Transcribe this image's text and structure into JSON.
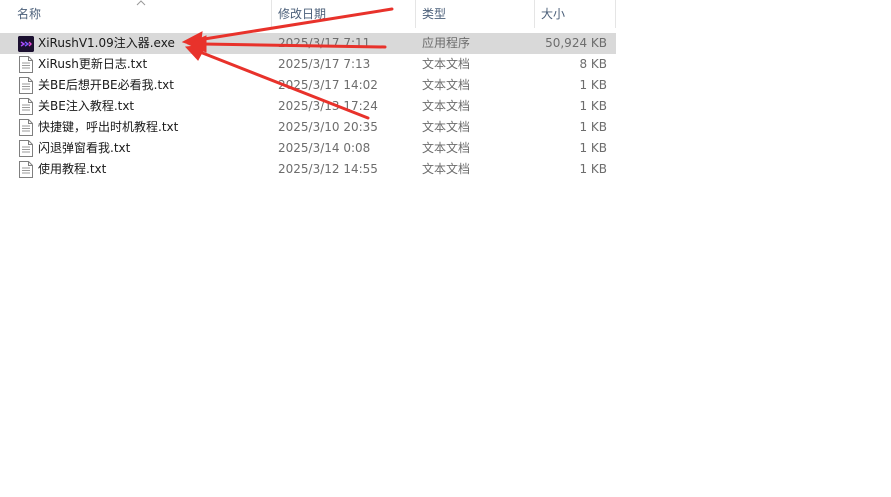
{
  "columns": {
    "name": "名称",
    "date_modified": "修改日期",
    "type": "类型",
    "size": "大小"
  },
  "files": [
    {
      "name": "XiRushV1.09注入器.exe",
      "date": "2025/3/17 7:11",
      "type": "应用程序",
      "size": "50,924 KB",
      "icon": "exe-app-icon",
      "selected": true
    },
    {
      "name": "XiRush更新日志.txt",
      "date": "2025/3/17 7:13",
      "type": "文本文档",
      "size": "8 KB",
      "icon": "text-file-icon",
      "selected": false
    },
    {
      "name": "关BE后想开BE必看我.txt",
      "date": "2025/3/17 14:02",
      "type": "文本文档",
      "size": "1 KB",
      "icon": "text-file-icon",
      "selected": false
    },
    {
      "name": "关BE注入教程.txt",
      "date": "2025/3/13 17:24",
      "type": "文本文档",
      "size": "1 KB",
      "icon": "text-file-icon",
      "selected": false
    },
    {
      "name": "快捷键，呼出时机教程.txt",
      "date": "2025/3/10 20:35",
      "type": "文本文档",
      "size": "1 KB",
      "icon": "text-file-icon",
      "selected": false
    },
    {
      "name": "闪退弹窗看我.txt",
      "date": "2025/3/14 0:08",
      "type": "文本文档",
      "size": "1 KB",
      "icon": "text-file-icon",
      "selected": false
    },
    {
      "name": "使用教程.txt",
      "date": "2025/3/12 14:55",
      "type": "文本文档",
      "size": "1 KB",
      "icon": "text-file-icon",
      "selected": false
    }
  ],
  "colors": {
    "header_text": "#4c607a",
    "selection": "#d9d9d9",
    "annotation_arrow": "#e8322b"
  }
}
